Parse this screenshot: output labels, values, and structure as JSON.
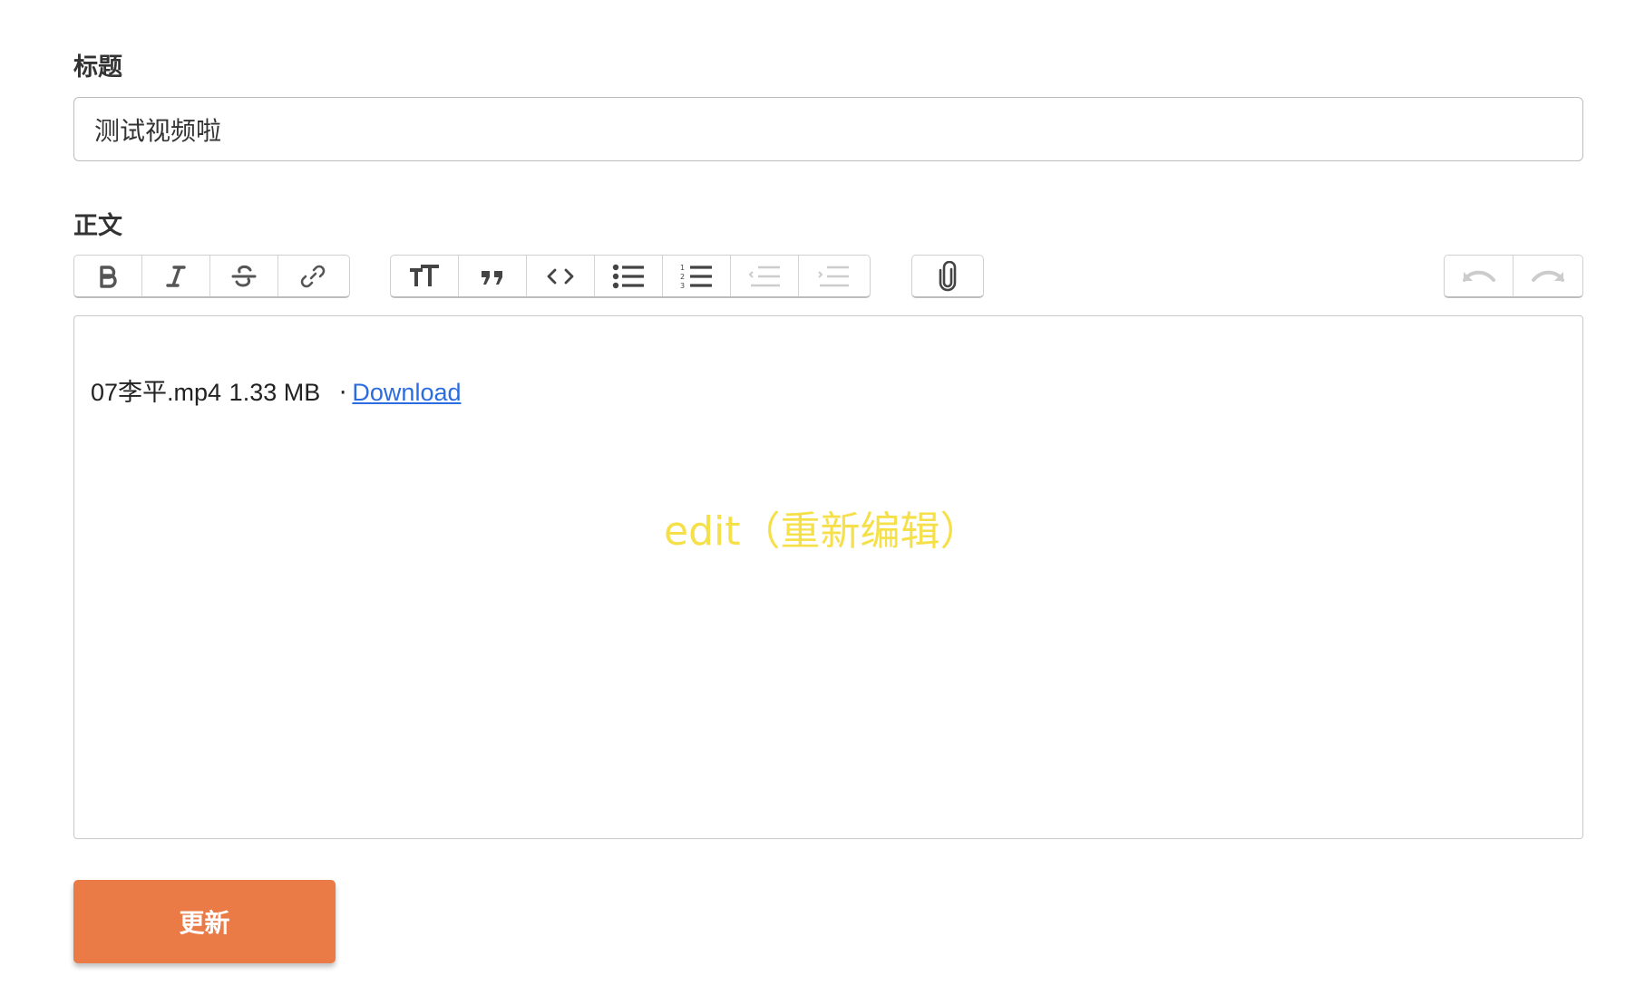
{
  "form": {
    "title_label": "标题",
    "title_value": "测试视频啦",
    "body_label": "正文",
    "submit_label": "更新"
  },
  "toolbar": {
    "text_tools": [
      {
        "name": "bold",
        "icon": "bold-icon"
      },
      {
        "name": "italic",
        "icon": "italic-icon"
      },
      {
        "name": "strikethrough",
        "icon": "strikethrough-icon"
      },
      {
        "name": "link",
        "icon": "link-icon"
      }
    ],
    "block_tools": [
      {
        "name": "heading",
        "icon": "heading-icon"
      },
      {
        "name": "quote",
        "icon": "quote-icon"
      },
      {
        "name": "code",
        "icon": "code-icon"
      },
      {
        "name": "bullet-list",
        "icon": "bullet-list-icon"
      },
      {
        "name": "numbered-list",
        "icon": "numbered-list-icon"
      },
      {
        "name": "decrease-indent",
        "icon": "outdent-icon",
        "disabled": true
      },
      {
        "name": "increase-indent",
        "icon": "indent-icon",
        "disabled": true
      }
    ],
    "file_tools": [
      {
        "name": "attach-file",
        "icon": "paperclip-icon"
      }
    ],
    "history_tools": [
      {
        "name": "undo",
        "icon": "undo-icon",
        "disabled": true
      },
      {
        "name": "redo",
        "icon": "redo-icon",
        "disabled": true
      }
    ]
  },
  "editor": {
    "attachment": {
      "filename_prefix": "07",
      "filename_cn": "李平",
      "filename_ext": ".mp4",
      "size": "1.33 MB",
      "separator": "·",
      "download_label": "Download"
    },
    "overlay_note": "edit（重新编辑）"
  },
  "colors": {
    "accent": "#ea7a46",
    "link": "#2b6de0",
    "overlay_note": "#f6e04a"
  }
}
